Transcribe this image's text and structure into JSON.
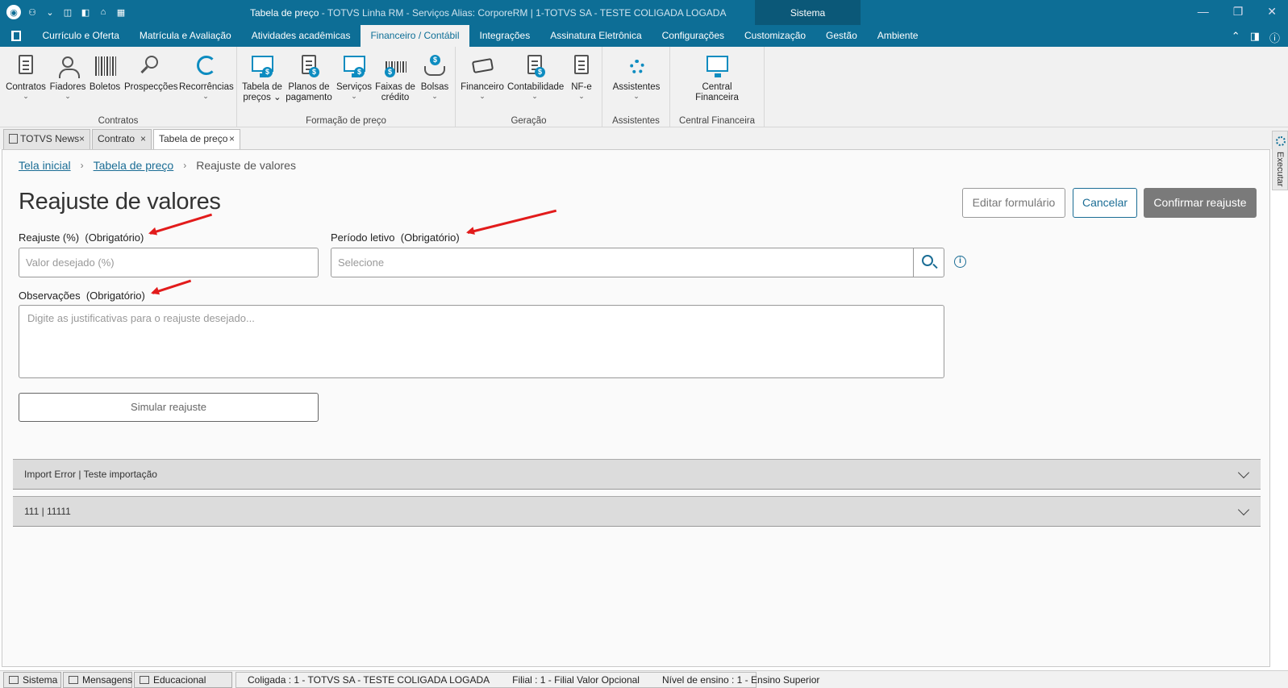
{
  "window": {
    "title": "Tabela de preço",
    "context": " - TOTVS Linha RM - Serviços  Alias: CorporeRM | 1-TOTVS SA - TESTE COLIGADA LOGADA",
    "system_label": "Sistema"
  },
  "menu": {
    "items": [
      "Currículo e Oferta",
      "Matrícula e Avaliação",
      "Atividades acadêmicas",
      "Financeiro / Contábil",
      "Integrações",
      "Assinatura Eletrônica",
      "Configurações",
      "Customização",
      "Gestão",
      "Ambiente"
    ],
    "active": "Financeiro / Contábil"
  },
  "ribbon": {
    "contratos": {
      "name": "Contratos",
      "buttons": [
        "Contratos",
        "Fiadores",
        "Boletos",
        "Prospecções",
        "Recorrências"
      ]
    },
    "formacao": {
      "name": "Formação de preço",
      "buttons": [
        [
          "Tabela de",
          "preços"
        ],
        [
          "Planos de",
          "pagamento"
        ],
        [
          "Serviços",
          ""
        ],
        [
          "Faixas de",
          "crédito"
        ],
        [
          "Bolsas",
          ""
        ]
      ]
    },
    "geracao": {
      "name": "Geração",
      "buttons": [
        "Financeiro",
        "Contabilidade",
        "NF-e"
      ]
    },
    "assistentes": {
      "name": "Assistentes",
      "buttons": [
        "Assistentes"
      ]
    },
    "central": {
      "name": "Central Financeira",
      "buttons": [
        [
          "Central",
          "Financeira"
        ]
      ]
    }
  },
  "doc_tabs": [
    "TOTVS News",
    "Contrato",
    "Tabela de preço"
  ],
  "side_panel": "Executar",
  "breadcrumb": {
    "home": "Tela inicial",
    "parent": "Tabela de preço",
    "current": "Reajuste de valores"
  },
  "page": {
    "title": "Reajuste de valores",
    "buttons": {
      "edit": "Editar formulário",
      "cancel": "Cancelar",
      "confirm": "Confirmar reajuste"
    },
    "fields": {
      "reajuste": {
        "label": "Reajuste (%)",
        "required": "(Obrigatório)",
        "placeholder": "Valor desejado (%)"
      },
      "periodo": {
        "label": "Período letivo",
        "required": "(Obrigatório)",
        "placeholder": "Selecione"
      },
      "observacoes": {
        "label": "Observações",
        "required": "(Obrigatório)",
        "placeholder": "Digite as justificativas para o reajuste desejado..."
      }
    },
    "simulate": "Simular reajuste",
    "accordions": [
      "Import Error | Teste importação",
      "111 | 11111"
    ]
  },
  "statusbar": {
    "tabs": [
      "Sistema",
      "Mensagens",
      "Educacional"
    ],
    "coligada": "Coligada : 1 - TOTVS SA - TESTE COLIGADA LOGADA",
    "filial": "Filial : 1 - Filial Valor Opcional",
    "nivel": "Nível de ensino : 1 - Ensino Superior"
  },
  "colors": {
    "brand": "#0d6e96",
    "annotation": "#e21b1b"
  }
}
